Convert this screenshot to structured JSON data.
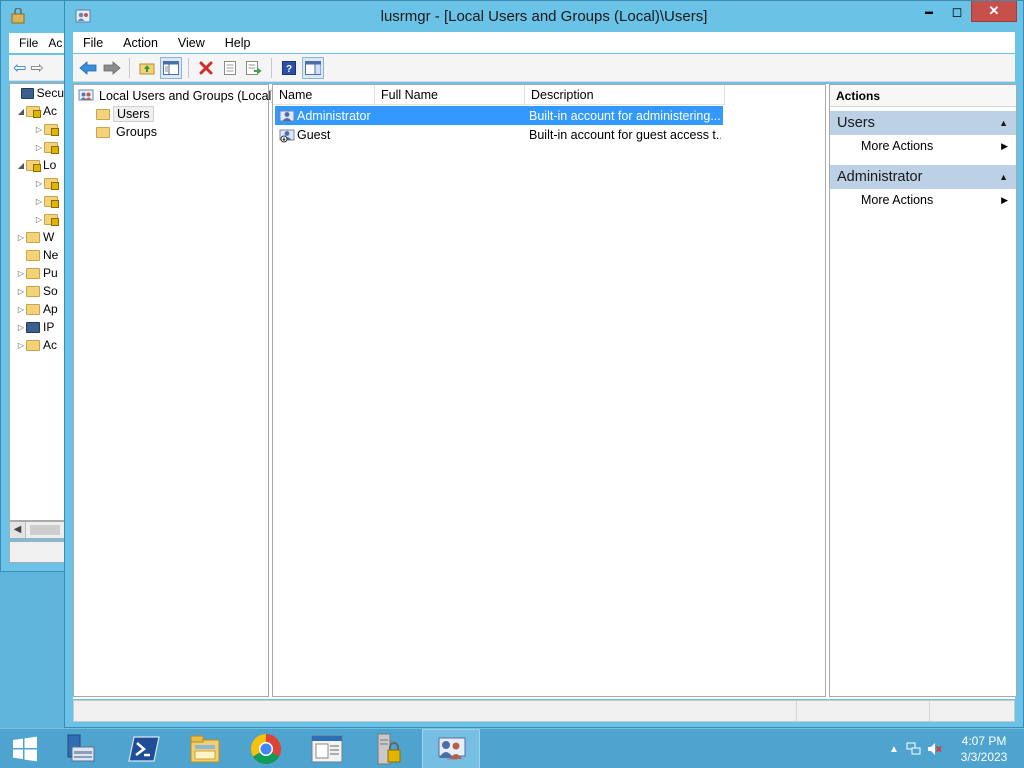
{
  "back_window": {
    "menu": [
      "File",
      "Ac"
    ],
    "tree": [
      {
        "label": "Secur",
        "indent": 0,
        "expander": "",
        "icon": "security-icon"
      },
      {
        "label": "Ac",
        "indent": 1,
        "expander": "◢",
        "icon": "lock-folder-icon"
      },
      {
        "label": "",
        "indent": 2,
        "expander": "▷",
        "icon": "lock-folder-icon"
      },
      {
        "label": "",
        "indent": 2,
        "expander": "▷",
        "icon": "lock-folder-icon"
      },
      {
        "label": "Lo",
        "indent": 1,
        "expander": "◢",
        "icon": "lock-folder-icon"
      },
      {
        "label": "",
        "indent": 2,
        "expander": "▷",
        "icon": "lock-folder-icon"
      },
      {
        "label": "",
        "indent": 2,
        "expander": "▷",
        "icon": "lock-folder-icon"
      },
      {
        "label": "",
        "indent": 2,
        "expander": "▷",
        "icon": "lock-folder-icon"
      },
      {
        "label": "W",
        "indent": 1,
        "expander": "▷",
        "icon": "folder-icon"
      },
      {
        "label": "Ne",
        "indent": 1,
        "expander": "",
        "icon": "folder-icon"
      },
      {
        "label": "Pu",
        "indent": 1,
        "expander": "▷",
        "icon": "folder-icon"
      },
      {
        "label": "So",
        "indent": 1,
        "expander": "▷",
        "icon": "folder-icon"
      },
      {
        "label": "Ap",
        "indent": 1,
        "expander": "▷",
        "icon": "folder-icon"
      },
      {
        "label": "IP",
        "indent": 1,
        "expander": "▷",
        "icon": "ip-security-icon"
      },
      {
        "label": "Ac",
        "indent": 1,
        "expander": "▷",
        "icon": "folder-icon"
      }
    ]
  },
  "window": {
    "title": "lusrmgr - [Local Users and Groups (Local)\\Users]",
    "minimize": "▬",
    "maximize": "◻",
    "close": "✕"
  },
  "menu": {
    "file": "File",
    "action": "Action",
    "view": "View",
    "help": "Help"
  },
  "tree": {
    "root": "Local Users and Groups (Local)",
    "users": "Users",
    "groups": "Groups"
  },
  "list": {
    "columns": {
      "name": "Name",
      "full_name": "Full Name",
      "description": "Description"
    },
    "rows": [
      {
        "name": "Administrator",
        "full_name": "",
        "description": "Built-in account for administering..."
      },
      {
        "name": "Guest",
        "full_name": "",
        "description": "Built-in account for guest access t..."
      }
    ]
  },
  "actions": {
    "title": "Actions",
    "groups": [
      {
        "label": "Users",
        "item": "More Actions"
      },
      {
        "label": "Administrator",
        "item": "More Actions"
      }
    ]
  },
  "taskbar": {
    "time": "4:07 PM",
    "date": "3/3/2023"
  },
  "colors": {
    "window_frame": "#6ac3e6",
    "taskbar": "#4fa4cf",
    "selection": "#3399ff",
    "close_button": "#c7504a",
    "action_group": "#bcd0e6"
  }
}
